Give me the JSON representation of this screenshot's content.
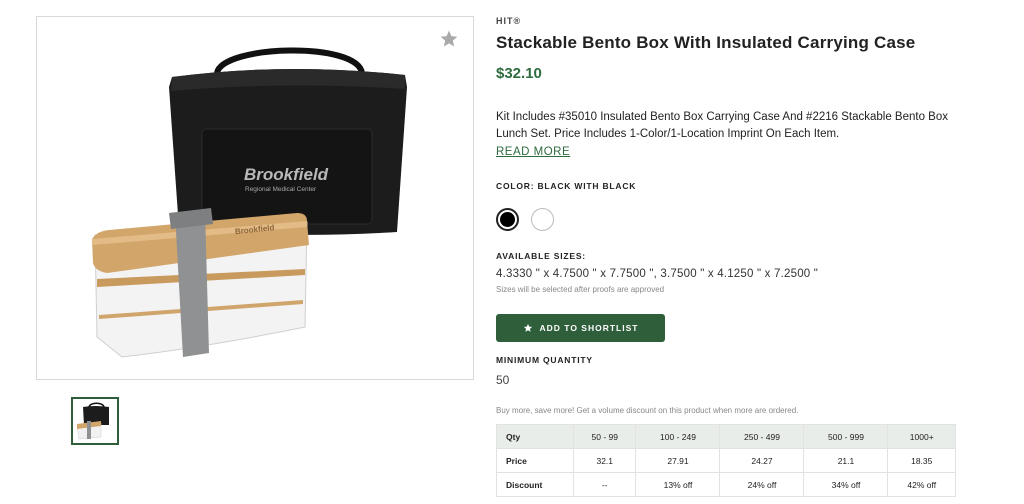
{
  "product": {
    "brand": "HIT®",
    "title": "Stackable Bento Box With Insulated Carrying Case",
    "price": "$32.10",
    "description": "Kit Includes #35010 Insulated Bento Box Carrying Case And #2216 Stackable Bento Box Lunch Set. Price Includes 1-Color/1-Location Imprint On Each Item.",
    "read_more": "READ MORE",
    "bag_imprint_line1": "Brookfield",
    "bag_imprint_line2": "Regional Medical Center",
    "lid_imprint": "Brookfield"
  },
  "color": {
    "label": "COLOR: BLACK WITH BLACK",
    "swatches": [
      "#000000",
      "#ffffff"
    ]
  },
  "sizes": {
    "label": "AVAILABLE SIZES:",
    "value": "4.3330 \" x 4.7500 \" x 7.7500 \", 3.7500 \" x 4.1250 \" x 7.2500 \"",
    "note": "Sizes will be selected after proofs are approved"
  },
  "shortlist": {
    "label": "ADD TO SHORTLIST"
  },
  "minimum": {
    "label": "MINIMUM QUANTITY",
    "value": "50"
  },
  "volume_note": "Buy more, save more! Get a volume discount on this product when more are ordered.",
  "pricing_table": {
    "headers": [
      "Qty",
      "50 - 99",
      "100 - 249",
      "250 - 499",
      "500 - 999",
      "1000+"
    ],
    "rows": [
      [
        "Price",
        "32.1",
        "27.91",
        "24.27",
        "21.1",
        "18.35"
      ],
      [
        "Discount",
        "--",
        "13% off",
        "24% off",
        "34% off",
        "42% off"
      ]
    ]
  },
  "colors": {
    "accent": "#2e5e3a",
    "price": "#2e6b3e"
  }
}
